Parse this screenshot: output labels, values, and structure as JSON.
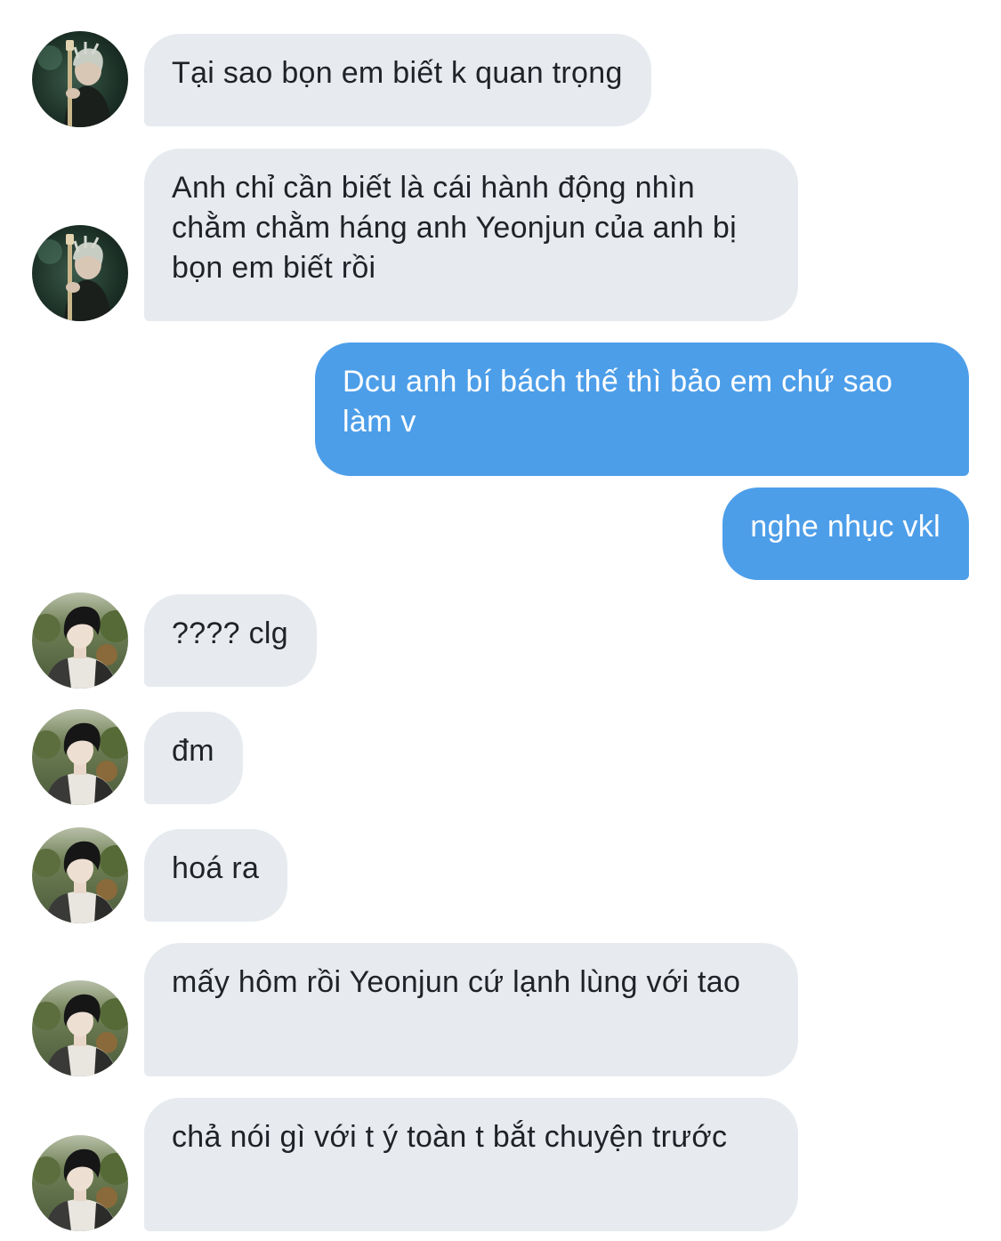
{
  "conversation": {
    "colors": {
      "incoming_bubble": "#e7ebef",
      "outgoing_bubble": "#4d9ee9",
      "incoming_text": "#1f2328",
      "outgoing_text": "#ffffff"
    },
    "avatars": {
      "first_sender": "avatar-guitarist-icon",
      "second_sender": "avatar-portrait-icon"
    },
    "messages": [
      {
        "direction": "incoming",
        "text": "Tại sao bọn em biết k quan trọng"
      },
      {
        "direction": "incoming",
        "text": "Anh chỉ cần biết là cái hành động nhìn chằm chằm háng anh Yeonjun của anh bị bọn em biết rồi"
      },
      {
        "direction": "outgoing",
        "text": "Dcu anh bí bách thế thì bảo em chứ sao làm v"
      },
      {
        "direction": "outgoing",
        "text": "nghe nhục vkl"
      },
      {
        "direction": "incoming",
        "text": "???? clg"
      },
      {
        "direction": "incoming",
        "text": "đm"
      },
      {
        "direction": "incoming",
        "text": "hoá ra"
      },
      {
        "direction": "incoming",
        "text": "mấy hôm rồi Yeonjun cứ lạnh lùng với tao"
      },
      {
        "direction": "incoming",
        "text": "chả nói gì với t ý toàn t bắt chuyện trước"
      }
    ]
  }
}
